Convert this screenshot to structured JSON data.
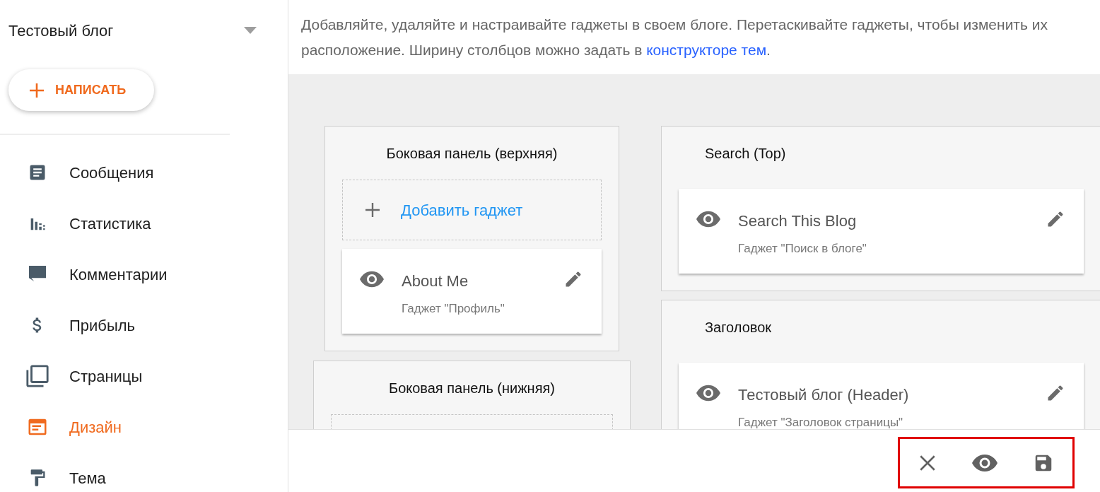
{
  "sidebar": {
    "blog_title": "Тестовый блог",
    "compose_label": "НАПИСАТЬ",
    "items": [
      {
        "label": "Сообщения",
        "selected": false
      },
      {
        "label": "Статистика",
        "selected": false
      },
      {
        "label": "Комментарии",
        "selected": false
      },
      {
        "label": "Прибыль",
        "selected": false
      },
      {
        "label": "Страницы",
        "selected": false
      },
      {
        "label": "Дизайн",
        "selected": true
      },
      {
        "label": "Тема",
        "selected": false
      }
    ]
  },
  "description": {
    "text": "Добавляйте, удаляйте и настраивайте гаджеты в своем блоге. Перетаскивайте гаджеты, чтобы изменить их расположение. Ширину столбцов можно задать в",
    "link": "конструкторе тем",
    "after": "."
  },
  "layout": {
    "columns": [
      {
        "sections": [
          {
            "title": "Боковая панель (верхняя)",
            "drop_zone": true,
            "add_gadget": "Добавить гаджет",
            "gadgets": [
              {
                "title": "About Me",
                "subtitle": "Гаджет \"Профиль\""
              }
            ]
          },
          {
            "title": "Боковая панель (нижняя)",
            "drop_zone": true
          }
        ]
      },
      {
        "sections": [
          {
            "title": "Search (Top)",
            "drop_zone": false,
            "gadgets": [
              {
                "title": "Search This Blog",
                "subtitle": "Гаджет \"Поиск в блоге\""
              }
            ]
          },
          {
            "title": "Заголовок",
            "drop_zone": false,
            "gadgets": [
              {
                "title": "Тестовый блог (Header)",
                "subtitle": "Гаджет \"Заголовок страницы\""
              }
            ]
          }
        ]
      }
    ]
  }
}
